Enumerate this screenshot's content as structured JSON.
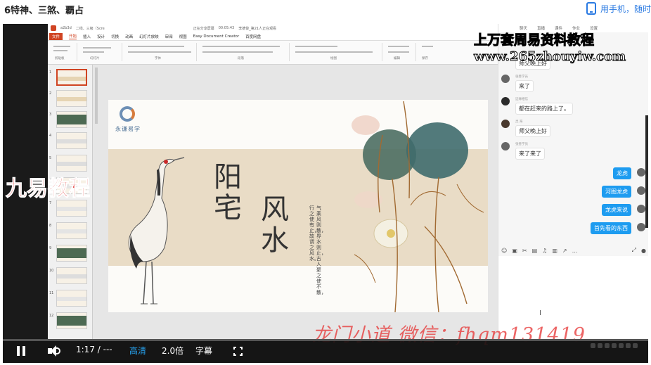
{
  "page": {
    "title": "6特神、三煞、覇占",
    "phone_link": "用手机，随时"
  },
  "ppt": {
    "titlebar": [
      "a2b3d",
      "二线、三级（Scre",
      "正在分享屏幕",
      "00:05:43",
      "李德俊_第21人正在观看"
    ],
    "tabs": [
      "文件",
      "开始",
      "插入",
      "设计",
      "切换",
      "动画",
      "幻灯片放映",
      "审阅",
      "视图",
      "Easy Document Creator",
      "百度网盘"
    ],
    "active_tab": "开始",
    "ribbon_groups": [
      "剪贴板",
      "幻灯片",
      "字体",
      "段落",
      "绘图",
      "编辑",
      "保存"
    ],
    "slide_numbers": [
      "1",
      "2",
      "3",
      "4",
      "5",
      "6",
      "7",
      "8",
      "9",
      "10",
      "11",
      "12"
    ],
    "slide": {
      "logo_text": "永谦易学",
      "title_a": "阳宅",
      "title_b": "风水",
      "poem_1": "气乘风则散，界水则止，古人聚之使不散，",
      "poem_2": "行之使有止，故谓之风水。"
    }
  },
  "chat": {
    "tabs": [
      "聊天",
      "直播",
      "课件",
      "作业",
      "设置"
    ],
    "top_partial": "师父晚上好",
    "messages": [
      {
        "name": "张善学员",
        "text": "来了"
      },
      {
        "name": "这缘相信",
        "text": "都在赶来的路上了。"
      },
      {
        "name": "灵 海",
        "text": "师父晚上好"
      },
      {
        "name": "张善学员",
        "text": "来了来了"
      }
    ],
    "right_messages": [
      "龙虎",
      "河图龙虎",
      "龙虎来说",
      "首先看的东西"
    ],
    "input_cursor": "I",
    "tools": [
      "☺",
      "▣",
      "✂",
      "▤",
      "♫",
      "▥",
      "↗",
      "…",
      "⤢",
      "●"
    ]
  },
  "overlays": {
    "watermark_top_1": "上万套周易资料教程",
    "watermark_top_2": "www.265zhouyiw.com",
    "watermark_left": "九易教程",
    "watermark_bottom": "龙门小道 微信：fhqm131419"
  },
  "player": {
    "time": "1:17 / ---",
    "quality": "高清",
    "speed": "2.0倍",
    "subtitle": "字幕",
    "progress": 0.0
  }
}
